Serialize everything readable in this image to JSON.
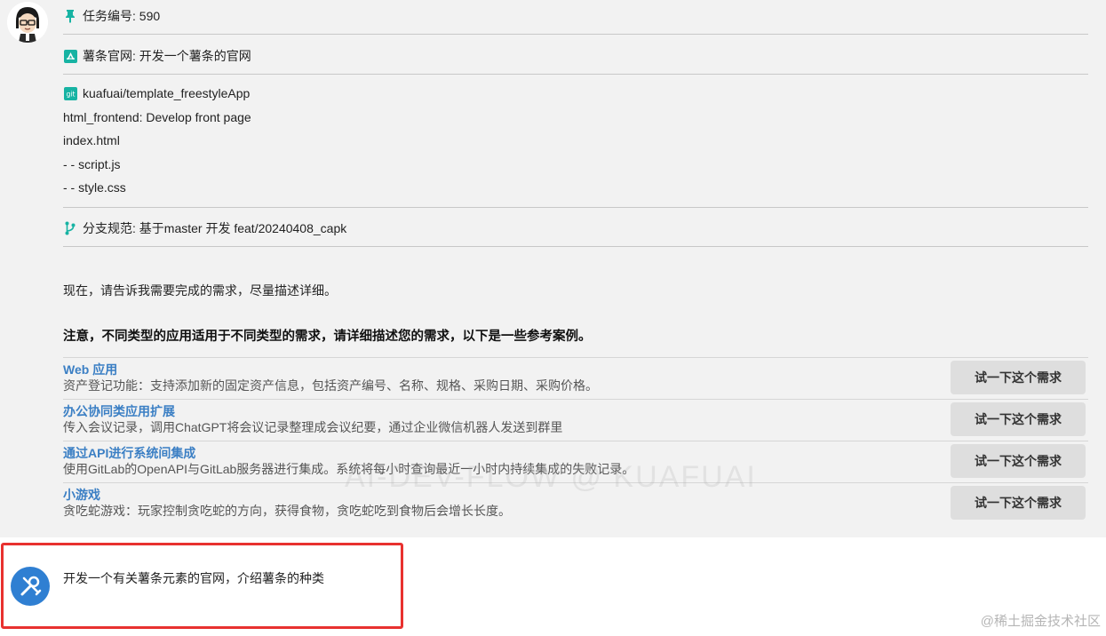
{
  "meta": {
    "task_label": "任务编号: 590",
    "project_label": "薯条官网: 开发一个薯条的官网",
    "repo": "kuafuai/template_freestyleApp",
    "files": [
      "html_frontend: Develop front page",
      "index.html",
      "- - script.js",
      "- - style.css"
    ],
    "branch_label": "分支规范: 基于master 开发 feat/20240408_capk"
  },
  "prompt": "现在，请告诉我需要完成的需求，尽量描述详细。",
  "notice": "注意，不同类型的应用适用于不同类型的需求，请详细描述您的需求，以下是一些参考案例。",
  "cases": [
    {
      "title": "Web 应用",
      "desc": "资产登记功能：支持添加新的固定资产信息，包括资产编号、名称、规格、采购日期、采购价格。",
      "button": "试一下这个需求"
    },
    {
      "title": "办公协同类应用扩展",
      "desc": "传入会议记录，调用ChatGPT将会议记录整理成会议纪要，通过企业微信机器人发送到群里",
      "button": "试一下这个需求"
    },
    {
      "title": "通过API进行系统间集成",
      "desc": "使用GitLab的OpenAPI与GitLab服务器进行集成。系统将每小时查询最近一小时内持续集成的失败记录。",
      "button": "试一下这个需求"
    },
    {
      "title": "小游戏",
      "desc": "贪吃蛇游戏：玩家控制贪吃蛇的方向，获得食物，贪吃蛇吃到食物后会增长长度。",
      "button": "试一下这个需求"
    }
  ],
  "user_message": "开发一个有关薯条元素的官网，介绍薯条的种类",
  "watermark": "AI-DEV-FLOW @ KUAFUAI",
  "site_mark": "@稀土掘金技术社区",
  "icons": {
    "task": "pin-icon",
    "project": "app-icon",
    "repo": "git-icon",
    "branch": "branch-icon"
  },
  "colors": {
    "accent": "#3b7fc4",
    "icon_teal": "#17b3a3",
    "highlight": "#e8312f",
    "user_avatar": "#2f7fd2"
  }
}
